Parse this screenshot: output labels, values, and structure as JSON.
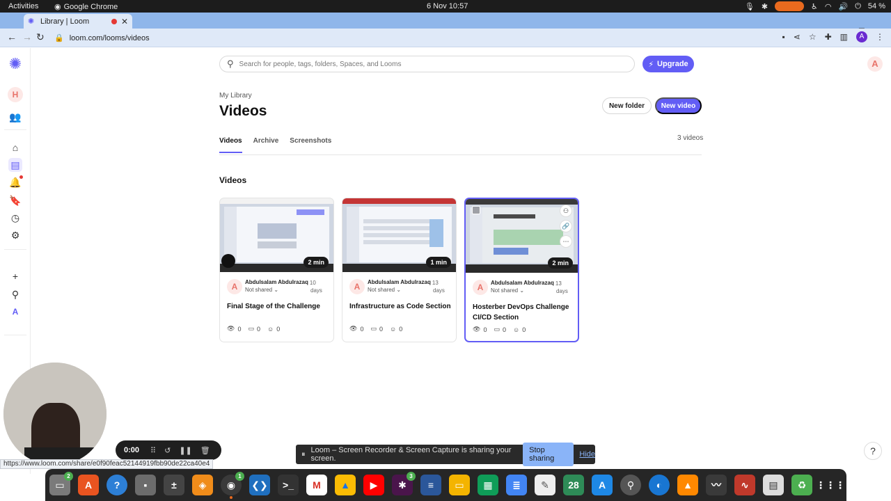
{
  "os": {
    "activities": "Activities",
    "app_name": "Google Chrome",
    "clock": "6 Nov  10:57",
    "battery": "54 %"
  },
  "browser": {
    "tab_title": "Library | Loom",
    "url": "loom.com/looms/videos",
    "profile_initial": "A",
    "status_url": "https://www.loom.com/share/e0f90feac52144919fbb90de22ca40e4"
  },
  "sidebar": {
    "workspace_initial": "H",
    "user_initial": "A"
  },
  "header": {
    "search_placeholder": "Search for people, tags, folders, Spaces, and Looms",
    "upgrade_label": "Upgrade",
    "avatar_initial": "A"
  },
  "library": {
    "breadcrumb": "My Library",
    "title": "Videos",
    "new_folder_label": "New folder",
    "new_video_label": "New video",
    "tabs": [
      {
        "label": "Videos",
        "active": true
      },
      {
        "label": "Archive",
        "active": false
      },
      {
        "label": "Screenshots",
        "active": false
      }
    ],
    "count": "3 videos",
    "section_title": "Videos"
  },
  "videos": [
    {
      "duration": "2 min",
      "author_initial": "A",
      "author": "Abdulsalam Abdulrazaq",
      "age_num": "· 10",
      "age_unit": "days",
      "shared": "Not shared",
      "title": "Final Stage of the Challenge",
      "views": "0",
      "comments": "0",
      "reactions": "0"
    },
    {
      "duration": "1 min",
      "author_initial": "A",
      "author": "Abdulsalam Abdulrazaq",
      "age_num": "· 13",
      "age_unit": "days",
      "shared": "Not shared",
      "title": "Infrastructure as Code Section",
      "views": "0",
      "comments": "0",
      "reactions": "0"
    },
    {
      "duration": "2 min",
      "author_initial": "A",
      "author": "Abdulsalam Abdulrazaq",
      "age_num": "· 13",
      "age_unit": "days",
      "shared": "Not shared",
      "title": "Hosterber DevOps Challenge CI/CD Section",
      "views": "0",
      "comments": "0",
      "reactions": "0"
    }
  ],
  "recorder": {
    "time": "0:00"
  },
  "share_notice": {
    "message": "Loom – Screen Recorder & Screen Capture is sharing your screen.",
    "stop_label": "Stop sharing",
    "hide_label": "Hide"
  },
  "help_label": "?",
  "dock": {
    "files_badge": "2",
    "chrome_badge": "1",
    "slack_badge": "3",
    "calendar_day": "28"
  },
  "colors": {
    "accent": "#625df5",
    "avatar_bg": "#fde8e6",
    "avatar_fg": "#e8736a",
    "tabstrip": "#8fb6ea"
  }
}
